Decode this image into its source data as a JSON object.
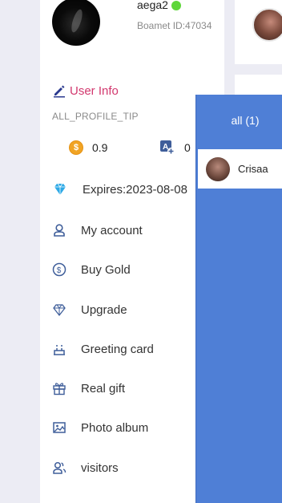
{
  "profile": {
    "username": "aega2",
    "boamet_id": "Boamet ID:47034",
    "online_color": "#5fd63b"
  },
  "user_info": {
    "label": "User Info",
    "tip": "ALL_PROFILE_TIP",
    "icon": "pen-icon"
  },
  "balances": {
    "gold": "0.9",
    "credits": "0"
  },
  "expires": "Expires:2023-08-08",
  "menu": [
    {
      "label": "My account",
      "icon": "user-icon"
    },
    {
      "label": "Buy Gold",
      "icon": "dollar-coin-icon"
    },
    {
      "label": "Upgrade",
      "icon": "diamond-icon"
    },
    {
      "label": "Greeting card",
      "icon": "cake-icon"
    },
    {
      "label": "Real gift",
      "icon": "gift-icon"
    },
    {
      "label": "Photo album",
      "icon": "image-icon"
    },
    {
      "label": "visitors",
      "icon": "visitors-icon"
    }
  ],
  "panel": {
    "tab_label": "all (1)",
    "items": [
      {
        "name": "Crisaa"
      }
    ]
  },
  "colors": {
    "accent_pink": "#d2386e",
    "panel_blue": "#4f7fd6",
    "icon_blue": "#3f5e9a",
    "coin_orange": "#f1a424"
  }
}
